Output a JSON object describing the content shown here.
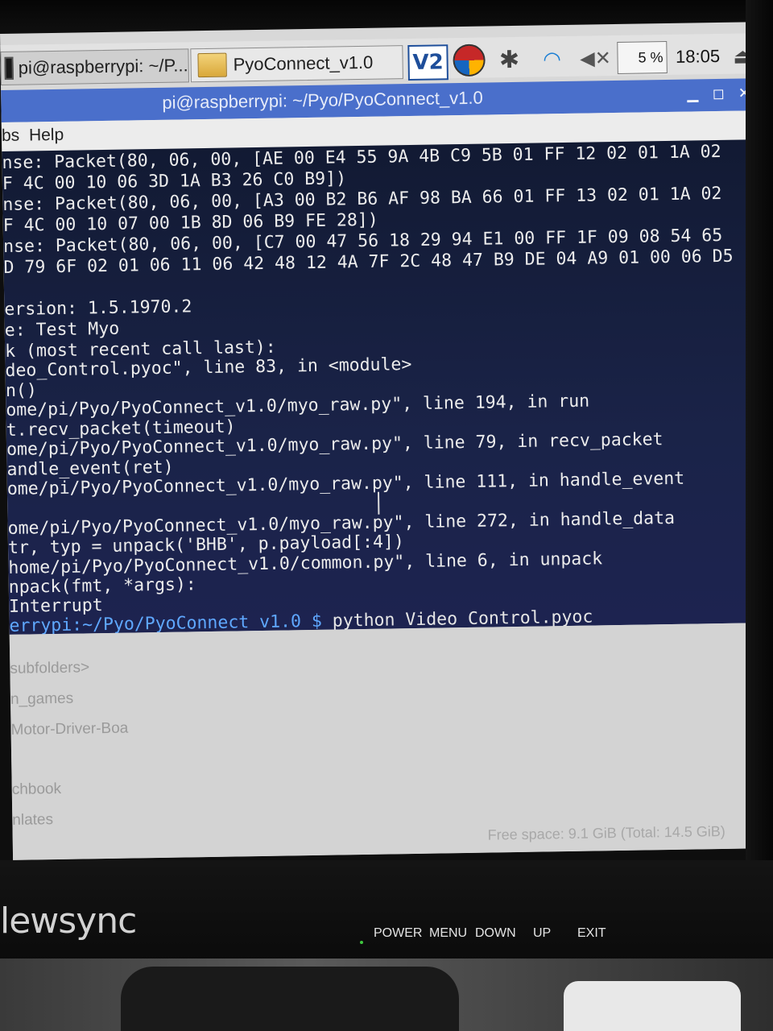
{
  "taskbar": {
    "tasks": [
      {
        "label": "pi@raspberrypi: ~/P..."
      },
      {
        "label": "PyoConnect_v1.0"
      }
    ],
    "vnc_label": "V2",
    "cpu_label": "5 %",
    "clock": "18:05"
  },
  "window": {
    "title": "pi@raspberrypi: ~/Pyo/PyoConnect_v1.0",
    "minimize_glyph": "▁",
    "maximize_glyph": "◻",
    "close_glyph": "✕"
  },
  "menu": {
    "items": [
      "bs",
      "Help"
    ]
  },
  "terminal": {
    "lines": [
      "nse: Packet(80, 06, 00, [AE 00 E4 55 9A 4B C9 5B 01 FF 12 02 01 1A 02",
      "F 4C 00 10 06 3D 1A B3 26 C0 B9])",
      "nse: Packet(80, 06, 00, [A3 00 B2 B6 AF 98 BA 66 01 FF 13 02 01 1A 02",
      "F 4C 00 10 07 00 1B 8D 06 B9 FE 28])",
      "nse: Packet(80, 06, 00, [C7 00 47 56 18 29 94 E1 00 FF 1F 09 08 54 65",
      "D 79 6F 02 01 06 11 06 42 48 12 4A 7F 2C 48 47 B9 DE 04 A9 01 00 06 D5",
      "",
      "ersion: 1.5.1970.2",
      "e: Test Myo",
      "k (most recent call last):",
      "deo_Control.pyoc\", line 83, in <module>",
      "n()",
      "ome/pi/Pyo/PyoConnect_v1.0/myo_raw.py\", line 194, in run",
      "t.recv_packet(timeout)",
      "ome/pi/Pyo/PyoConnect_v1.0/myo_raw.py\", line 79, in recv_packet",
      "andle_event(ret)",
      "ome/pi/Pyo/PyoConnect_v1.0/myo_raw.py\", line 111, in handle_event",
      "",
      "ome/pi/Pyo/PyoConnect_v1.0/myo_raw.py\", line 272, in handle_data",
      "tr, typ = unpack('BHB', p.payload[:4])",
      "home/pi/Pyo/PyoConnect_v1.0/common.py\", line 6, in unpack",
      "npack(fmt, *args):",
      "Interrupt"
    ],
    "prompt": "errypi:~/Pyo/PyoConnect_v1.0 $",
    "command": " python Video_Control.pyoc_"
  },
  "file_manager": {
    "items": [
      "subfolders>",
      "n_games",
      "Motor-Driver-Boa",
      "chbook",
      "nlates"
    ],
    "status": "Free space: 9.1 GiB (Total: 14.5 GiB)"
  },
  "monitor": {
    "brand": "lewsync",
    "controls": [
      "POWER",
      "MENU",
      "DOWN",
      "UP",
      "EXIT"
    ]
  }
}
